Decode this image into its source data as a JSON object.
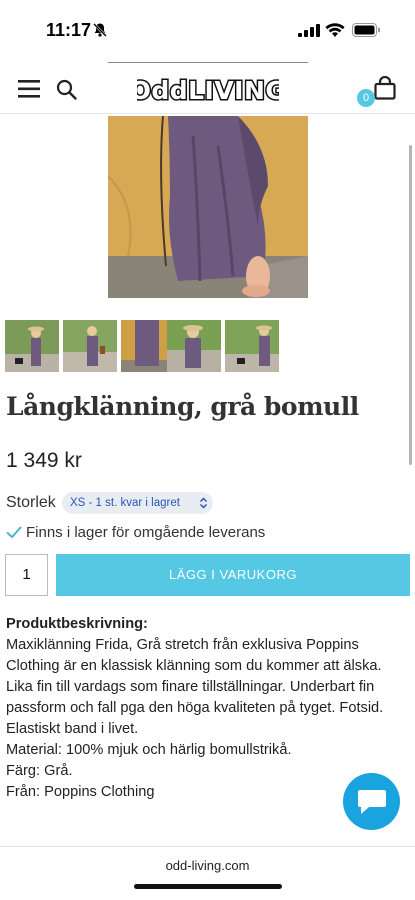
{
  "status": {
    "time": "11:17"
  },
  "header": {
    "logo": "OddLIVING",
    "cart_count": "0"
  },
  "product": {
    "title": "Långklänning, grå bomull",
    "price": "1 349 kr",
    "size_label": "Storlek",
    "size_selected": "XS - 1 st. kvar i lagret",
    "stock_text": "Finns i lager för omgående leverans",
    "quantity": "1",
    "add_to_cart_label": "LÄGG I VARUKORG"
  },
  "description": {
    "heading": "Produktbeskrivning:",
    "paragraph": "Maxiklänning Frida, Grå stretch från exklusiva Poppins Clothing är en klassisk klänning som du kommer att älska. Lika fin till vardags som finare tillställningar. Underbart fin passform och fall pga den höga kvaliteten på tyget. Fotsid. Elastiskt band i livet.",
    "material": "Material: 100% mjuk och härlig bomullstrikå.",
    "color": "Färg: Grå.",
    "brand": "Från: Poppins Clothing"
  },
  "browser": {
    "url": "odd-living.com"
  },
  "colors": {
    "accent": "#55c8e4",
    "chat": "#1aa4df",
    "size_text": "#2a56b5",
    "check": "#4fb3cf"
  }
}
